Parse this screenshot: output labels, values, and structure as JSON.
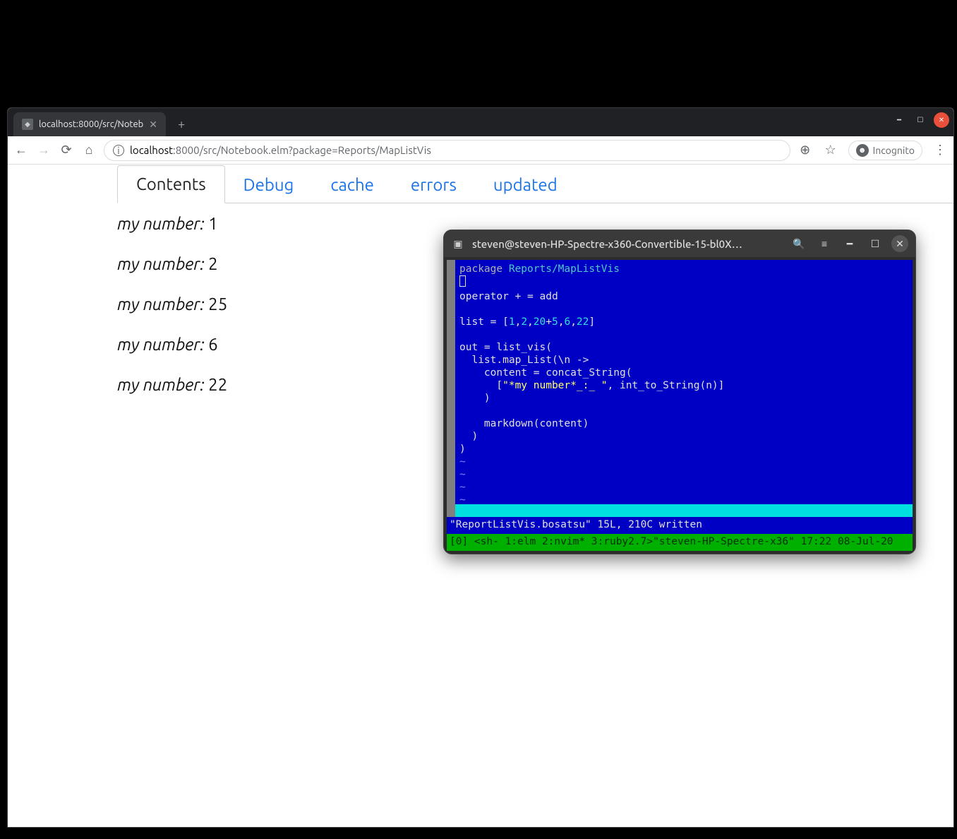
{
  "browser": {
    "tab_title": "localhost:8000/src/Noteb",
    "url_host": "localhost",
    "url_port_path": ":8000/src/Notebook.elm?package=Reports/MapListVis",
    "incognito_label": "Incognito"
  },
  "page": {
    "tabs": [
      {
        "label": "Contents",
        "active": true
      },
      {
        "label": "Debug",
        "active": false
      },
      {
        "label": "cache",
        "active": false
      },
      {
        "label": "errors",
        "active": false
      },
      {
        "label": "updated",
        "active": false
      }
    ],
    "item_label": "my number:",
    "items": [
      "1",
      "2",
      "25",
      "6",
      "22"
    ]
  },
  "terminal": {
    "title": "steven@steven-HP-Spectre-x360-Convertible-15-bl0X…",
    "code": {
      "l1a": "package",
      "l1b": " Reports/MapListVis",
      "l2": "",
      "l3a": "operator ",
      "l3b": "+ = add",
      "l4": "",
      "l5a": "list = [",
      "l5n1": "1",
      "l5c1": ",",
      "l5n2": "2",
      "l5c2": ",",
      "l5n3": "20",
      "l5p": "+",
      "l5n4": "5",
      "l5c3": ",",
      "l5n5": "6",
      "l5c4": ",",
      "l5n6": "22",
      "l5b": "]",
      "l6": "",
      "l7": "out = list_vis(",
      "l8": "  list.map_List(\\n ->",
      "l9": "    content = concat_String(",
      "l10a": "      [",
      "l10s": "\"*my number*_:_ \"",
      "l10b": ", int_to_String(n)]",
      "l11": "    )",
      "l12": "",
      "l13": "    markdown(content)",
      "l14": "  )",
      "l15": ")"
    },
    "status_line": "\"ReportListVis.bosatsu\" 15L, 210C written",
    "tmux": "[0] <sh- 1:elm  2:nvim* 3:ruby2.7>\"steven-HP-Spectre-x36\" 17:22 08-Jul-20"
  }
}
